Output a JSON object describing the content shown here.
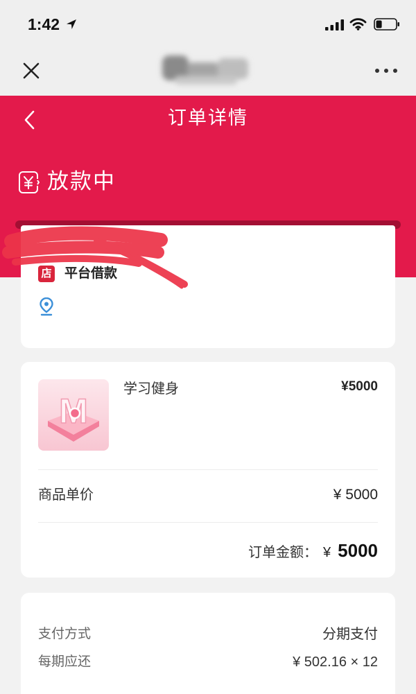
{
  "status_bar": {
    "time": "1:42",
    "battery_level": 0.3,
    "icons": [
      "location-arrow-icon",
      "signal-icon",
      "wifi-icon",
      "battery-icon"
    ]
  },
  "nav_bar": {
    "left_icon": "close-icon",
    "right_icon": "more-icon"
  },
  "header": {
    "back_icon": "back-icon",
    "title": "订单详情",
    "status_icon": "yuan-receipt-icon",
    "status": "放款中"
  },
  "shop": {
    "badge": "店",
    "name": "平台借款",
    "location_icon": "location-pin-icon"
  },
  "product": {
    "image_logo_letter": "M",
    "name": "学习健身",
    "price": "¥5000"
  },
  "order_summary": {
    "unit_price_label": "商品单价",
    "unit_price_value": "¥ 5000",
    "total_label": "订单金额：",
    "total_currency": "¥",
    "total_value": "5000"
  },
  "payment": {
    "method_label": "支付方式",
    "method_value": "分期支付",
    "installment_label": "每期应还",
    "installment_value": "¥ 502.16 × 12"
  },
  "colors": {
    "accent": "#e31a4b",
    "slot_shadow": "#a30f33",
    "store_badge": "#d9253c",
    "location_pin": "#3b8fd8",
    "page_background": "#f2f2f2",
    "top_bar_background": "#efefef"
  }
}
